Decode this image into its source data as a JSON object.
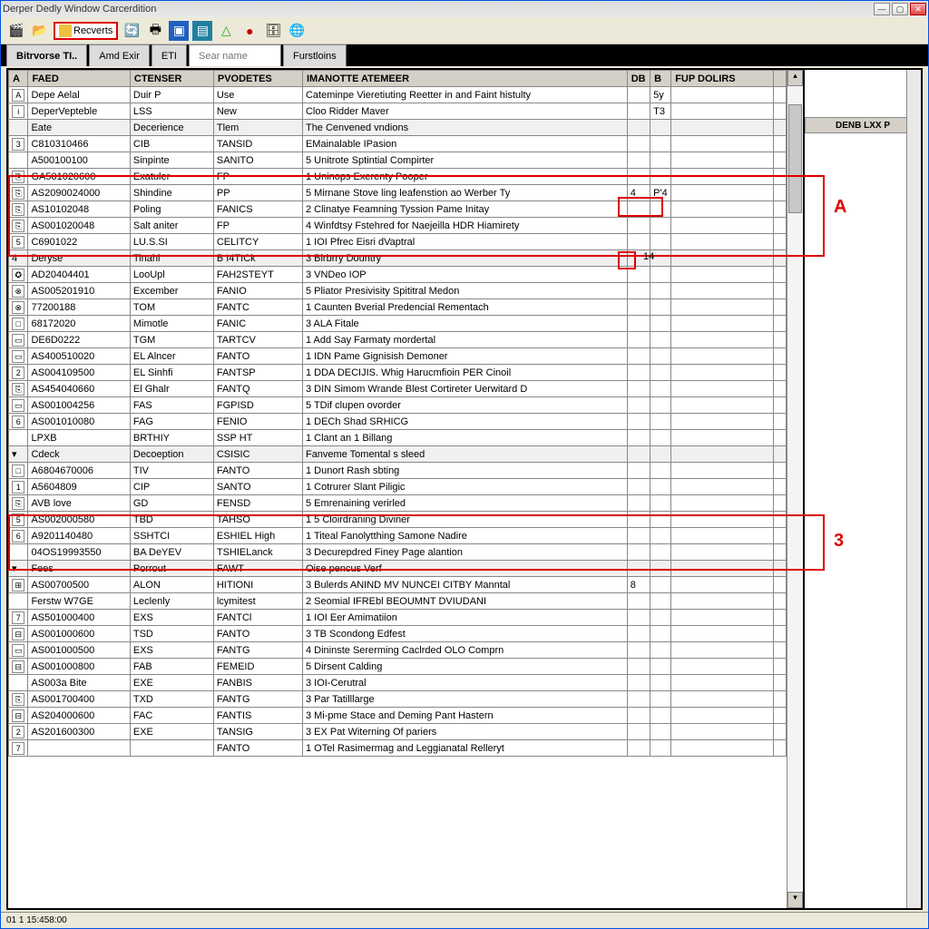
{
  "window": {
    "title": "Derper Dedly Window Carcerdition"
  },
  "toolbar": {
    "recents_label": "Recverts"
  },
  "tabs": {
    "t1": "Bitrvorse TI..",
    "t2": "Amd Exir",
    "t3": "ETI",
    "search_placeholder": "Sear name",
    "t5": "Furstloins"
  },
  "headers": {
    "icon": "A",
    "faed": "FAED",
    "ctenser": "CTENSER",
    "pvodetes": "PVODETES",
    "imanotte": "IMANOTTE ATEMEER",
    "d1": "DB",
    "b": "B",
    "fup": "FUP DOLIRS"
  },
  "right": {
    "header": "DENB LXX P",
    "val14": "14"
  },
  "annotations": {
    "A": "A",
    "three": "3"
  },
  "status": {
    "text": "01 1 15:458:00"
  },
  "preheader1": {
    "faed": "Depe Aelal",
    "ct": "Duir P",
    "pv": "Use",
    "im": "Cateminpe Vieretiuting Reetter in and Faint histulty",
    "b": "5y"
  },
  "preheader2": {
    "faed": "DeperVepteble",
    "ct": "LSS",
    "pv": "New",
    "im": "Cloo Ridder Maver",
    "b": "T3"
  },
  "section1": {
    "faed": "Eate",
    "ct": "Decerience",
    "pv": "Tlem",
    "im": "The Cenvened vndions"
  },
  "rows1": [
    {
      "i": "3",
      "f": "C810310466",
      "c": "CIB",
      "p": "TANSID",
      "m": "EMainalable IPasion"
    },
    {
      "i": "",
      "f": "A500100100",
      "c": "Sinpinte",
      "p": "SANITO",
      "m": "5 Unitrote Sptintial Compirter"
    },
    {
      "i": "⎘",
      "f": "GA501020600",
      "c": "Exatuler",
      "p": "FP",
      "m": "1 Uninops Exerenty Pooper",
      "hl": true
    },
    {
      "i": "⎘",
      "f": "AS2090024000",
      "c": "Shindine",
      "p": "PP",
      "m": "5 Mirnane Stove ling leafenstion ao Werber Ty",
      "d": "4",
      "b": "P'4",
      "hl": true
    },
    {
      "i": "⎘",
      "f": "AS10102048",
      "c": "Poling",
      "p": "FANICS",
      "m": "2 Clinatye Feamning Tyssion Pame Initay",
      "hl": true
    },
    {
      "i": "⎘",
      "f": "AS001020048",
      "c": "Salt aniter",
      "p": "FP",
      "m": "4 Winfdtsy Fstehred for Naejeilla HDR Hiamirety",
      "hl": true,
      "hl_im_only": true
    },
    {
      "i": "5",
      "f": "C6901022",
      "c": "LU.S.SI",
      "p": "CELITCY",
      "m": "1 IOI Pfrec Eisri dVaptral",
      "hl_im": true
    }
  ],
  "section2": {
    "i": "4",
    "faed": "Deryse",
    "ct": "Tinahl",
    "pv": "B I4TICk",
    "im": "3 Birbrry Dountry"
  },
  "rows2": [
    {
      "i": "✪",
      "f": "AD20404401",
      "c": "LooUpl",
      "p": "FAH2STEYT",
      "m": "3 VNDeo IOP"
    },
    {
      "i": "⊗",
      "f": "AS005201910",
      "c": "Excember",
      "p": "FANIO",
      "m": "5 Pliator Presivisity Spititral Medon"
    },
    {
      "i": "⊗",
      "f": "77200188",
      "c": "TOM",
      "p": "FANTC",
      "m": "1 Caunten Bverial Predencial Rementach"
    },
    {
      "i": "□",
      "f": "68172020",
      "c": "Mimotle",
      "p": "FANIC",
      "m": "3 ALA Fitale"
    },
    {
      "i": "▭",
      "f": "DE6D0222",
      "c": "TGM",
      "p": "TARTCV",
      "m": "1 Add Say Farmaty mordertal"
    },
    {
      "i": "▭",
      "f": "AS400510020",
      "c": "EL Alncer",
      "p": "FANTO",
      "m": "1 IDN Pame Gignisish Demoner"
    },
    {
      "i": "2",
      "f": "AS004109500",
      "c": "EL Sinhfi",
      "p": "FANTSP",
      "m": "1 DDA DECIJIS. Whig Harucmfioin PER Cinoil"
    },
    {
      "i": "⎘",
      "f": "AS454040660",
      "c": "El Ghalr",
      "p": "FANTQ",
      "m": "3 DIN Simom Wrande Blest Cortireter Uerwitard D",
      "hl": true
    },
    {
      "i": "▭",
      "f": "AS001004256",
      "c": "FAS",
      "p": "FGPISD",
      "m": "5 TDif clupen ovorder"
    },
    {
      "i": "6",
      "f": "AS001010080",
      "c": "FAG",
      "p": "FENIO",
      "m": "1 DECh Shad SRHICG"
    },
    {
      "i": "",
      "f": "LPXB",
      "c": "BRTHIY",
      "p": "SSP HT",
      "m": "1 Clant an 1 Billang"
    }
  ],
  "section3": {
    "faed": "Cdeck",
    "ct": "Decoeption",
    "pv": "CSISIC",
    "im": "Fanveme Tomental s sleed"
  },
  "rows3": [
    {
      "i": "□",
      "f": "A6804670006",
      "c": "TIV",
      "p": "FANTO",
      "m": "1 Dunort Rash sbting",
      "hl": true
    },
    {
      "i": "1",
      "f": "A5604809",
      "c": "CIP",
      "p": "SANTO",
      "m": "1 Cotrurer Slant Piligic",
      "hl": true
    },
    {
      "i": "⎘",
      "f": "AVB love",
      "c": "GD",
      "p": "FENSD",
      "m": "5 Emrenaining verirled",
      "hl": true
    },
    {
      "i": "5",
      "f": "AS002000580",
      "c": "TBD",
      "p": "TAHSO",
      "m": "1 5 Cloirdraning Diviner"
    },
    {
      "i": "6",
      "f": "A9201140480",
      "c": "SSHTCI",
      "p": "ESHIEL High",
      "m": "1 Titeal Fanolytthing Samone Nadire"
    },
    {
      "i": "",
      "f": "04OS19993550",
      "c": "BA DeYEV",
      "p": "TSHIELanck",
      "m": "3 Decurepdred Finey Page alantion"
    }
  ],
  "section4": {
    "faed": "Fees",
    "ct": "Porrout",
    "pv": "FAWT",
    "im": "Oise pencus Verf"
  },
  "rows4": [
    {
      "i": "⊞",
      "f": "AS00700500",
      "c": "ALON",
      "p": "HITIONI",
      "m": "3 Bulerds ANIND MV NUNCEI CITBY Manntal",
      "d": "8",
      "hl": true
    },
    {
      "i": "",
      "f": "Ferstw W7GE",
      "c": "Leclenly",
      "p": "lcymitest",
      "m": "2 Seomial IFREbl BEOUMNT DVIUDANI",
      "hl": true
    },
    {
      "i": "7",
      "f": "AS501000400",
      "c": "EXS",
      "p": "FANTCl",
      "m": "1 IOI Eer Amimatiion"
    },
    {
      "i": "⊟",
      "f": "AS001000600",
      "c": "TSD",
      "p": "FANTO",
      "m": "3 TB Scondong Edfest"
    },
    {
      "i": "▭",
      "f": "AS001000500",
      "c": "EXS",
      "p": "FANTG",
      "m": "4 Dininste Sererming Caclrded OLO Comprn"
    },
    {
      "i": "⊟",
      "f": "AS001000800",
      "c": "FAB",
      "p": "FEMEID",
      "m": "5 Dirsent Calding"
    },
    {
      "i": "",
      "f": "AS003a Bite",
      "c": "EXE",
      "p": "FANBIS",
      "m": "3 IOI-Cerutral"
    },
    {
      "i": "⎘",
      "f": "AS001700400",
      "c": "TXD",
      "p": "FANTG",
      "m": "3 Par Tatilllarge"
    },
    {
      "i": "⊟",
      "f": "AS204000600",
      "c": "FAC",
      "p": "FANTIS",
      "m": "3 Mi-pme Stace and Deming Pant Hastern"
    },
    {
      "i": "2",
      "f": "AS201600300",
      "c": "EXE",
      "p": "TANSIG",
      "m": "3 EX Pat Witerning Of pariers"
    },
    {
      "i": "7",
      "f": "",
      "c": "",
      "p": "FANTO",
      "m": "1 OTel Rasimermag and Leggianatal Relleryt"
    }
  ]
}
